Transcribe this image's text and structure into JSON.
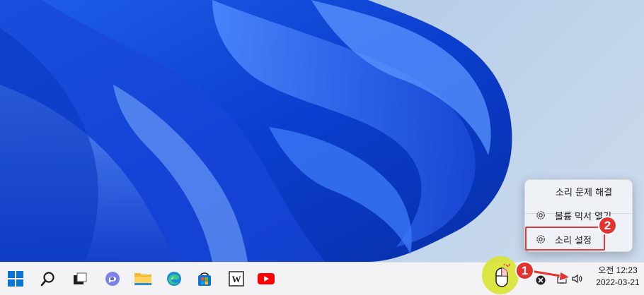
{
  "context_menu": {
    "items": [
      {
        "label": "소리 문제 해결"
      },
      {
        "label": "볼륨 믹서 열기"
      },
      {
        "label": "소리 설정"
      }
    ]
  },
  "badges": {
    "step1": "1",
    "step2": "2"
  },
  "taskbar": {
    "apps": [
      "windows-start",
      "search",
      "task-view",
      "teams-chat",
      "file-explorer",
      "edge",
      "microsoft-store",
      "wikipedia",
      "youtube"
    ]
  },
  "clock": {
    "time": "오전 12:23",
    "date": "2022-03-21"
  },
  "colors": {
    "accent_red": "#e23b3b",
    "taskbar_bg": "#f3f3f5",
    "highlight_yellow": "#d9e43a"
  }
}
